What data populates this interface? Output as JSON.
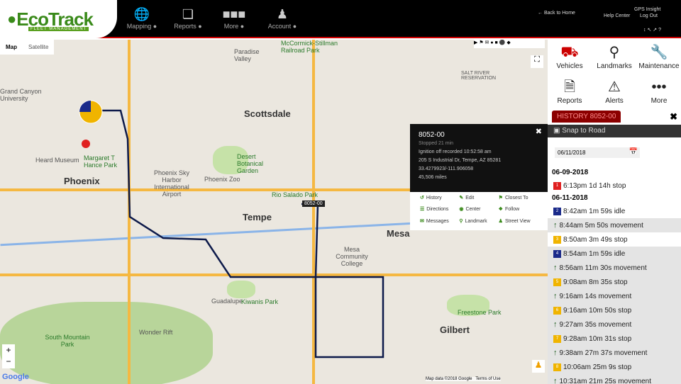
{
  "header": {
    "logo": "EcoTrack",
    "logo_sub": "FLEET MANAGEMENT",
    "nav": [
      {
        "label": "Mapping",
        "icon": "globe-icon"
      },
      {
        "label": "Reports",
        "icon": "reports-icon"
      },
      {
        "label": "More",
        "icon": "more-icon"
      },
      {
        "label": "Account",
        "icon": "user-icon"
      }
    ],
    "back_home": "Back to Home",
    "company": "GPS Insight",
    "help": "Help Center",
    "logout": "Log Out"
  },
  "map": {
    "tab_map": "Map",
    "tab_satellite": "Satellite",
    "vehicle_label": "8052-00",
    "footer_data": "Map data ©2018 Google",
    "footer_terms": "Terms of Use",
    "google": "Google",
    "labels": {
      "phoenix": "Phoenix",
      "scottsdale": "Scottsdale",
      "tempe": "Tempe",
      "mesa": "Mesa",
      "gilbert": "Gilbert",
      "guadalupe": "Guadalupe",
      "paradise": "Paradise Valley",
      "airport": "Phoenix Sky Harbor International Airport",
      "zoo": "Phoenix Zoo",
      "garden": "Desert Botanical Garden",
      "heard": "Heard Museum",
      "hance": "Margaret T Hance Park",
      "southmtn": "South Mountain Park",
      "kiwanis": "Kiwanis Park",
      "freestone": "Freestone Park",
      "mcc": "Mesa Community College",
      "srr": "SALT RIVER RESERVATION",
      "mccormick": "McCormick-Stillman Railroad Park",
      "gcu": "Grand Canyon University",
      "wonder": "Wonder Rift",
      "riosalado": "Rio Salado Park"
    }
  },
  "popup": {
    "title": "8052-00",
    "status": "Stopped 21 min",
    "ignition": "Ignition off recorded 10:52:58 am",
    "address": "205 S Industrial Dr, Tempe, AZ 85281",
    "coords": "33.4279923/-111.906058",
    "miles": "45,506 miles",
    "actions": [
      "History",
      "Edit",
      "Closest To",
      "Directions",
      "Center",
      "Follow",
      "Messages",
      "Landmark",
      "Street View"
    ]
  },
  "sidebar": {
    "tiles": [
      "Vehicles",
      "Landmarks",
      "Maintenance",
      "Reports",
      "Alerts",
      "More"
    ],
    "history_tab": "HISTORY 8052-00",
    "snap": "Snap to Road",
    "date": "06/11/2018",
    "groups": [
      {
        "date": "06-09-2018",
        "items": [
          {
            "type": "stop",
            "n": "1",
            "text": "6:13pm 1d 14h stop",
            "color": "#e02020"
          }
        ]
      },
      {
        "date": "06-11-2018",
        "items": [
          {
            "type": "idle",
            "n": "2",
            "text": "8:42am 1m 59s idle",
            "color": "#1a2a8a"
          },
          {
            "type": "move",
            "text": "8:44am 5m 50s movement"
          },
          {
            "type": "stop",
            "n": "3",
            "text": "8:50am 3m 49s stop",
            "color": "#f0b400"
          },
          {
            "type": "idle",
            "n": "4",
            "text": "8:54am 1m 59s idle",
            "color": "#1a2a8a"
          },
          {
            "type": "move",
            "text": "8:56am 11m 30s movement"
          },
          {
            "type": "stop",
            "n": "5",
            "text": "9:08am 8m 35s stop",
            "color": "#f0b400"
          },
          {
            "type": "move",
            "text": "9:16am 14s movement"
          },
          {
            "type": "stop",
            "n": "6",
            "text": "9:16am 10m 50s stop",
            "color": "#f0b400"
          },
          {
            "type": "move",
            "text": "9:27am 35s movement"
          },
          {
            "type": "stop",
            "n": "7",
            "text": "9:28am 10m 31s stop",
            "color": "#f0b400"
          },
          {
            "type": "move",
            "text": "9:38am 27m 37s movement"
          },
          {
            "type": "stop",
            "n": "8",
            "text": "10:06am 25m 9s stop",
            "color": "#f0b400"
          },
          {
            "type": "move",
            "text": "10:31am 21m 25s movement"
          }
        ]
      }
    ]
  }
}
